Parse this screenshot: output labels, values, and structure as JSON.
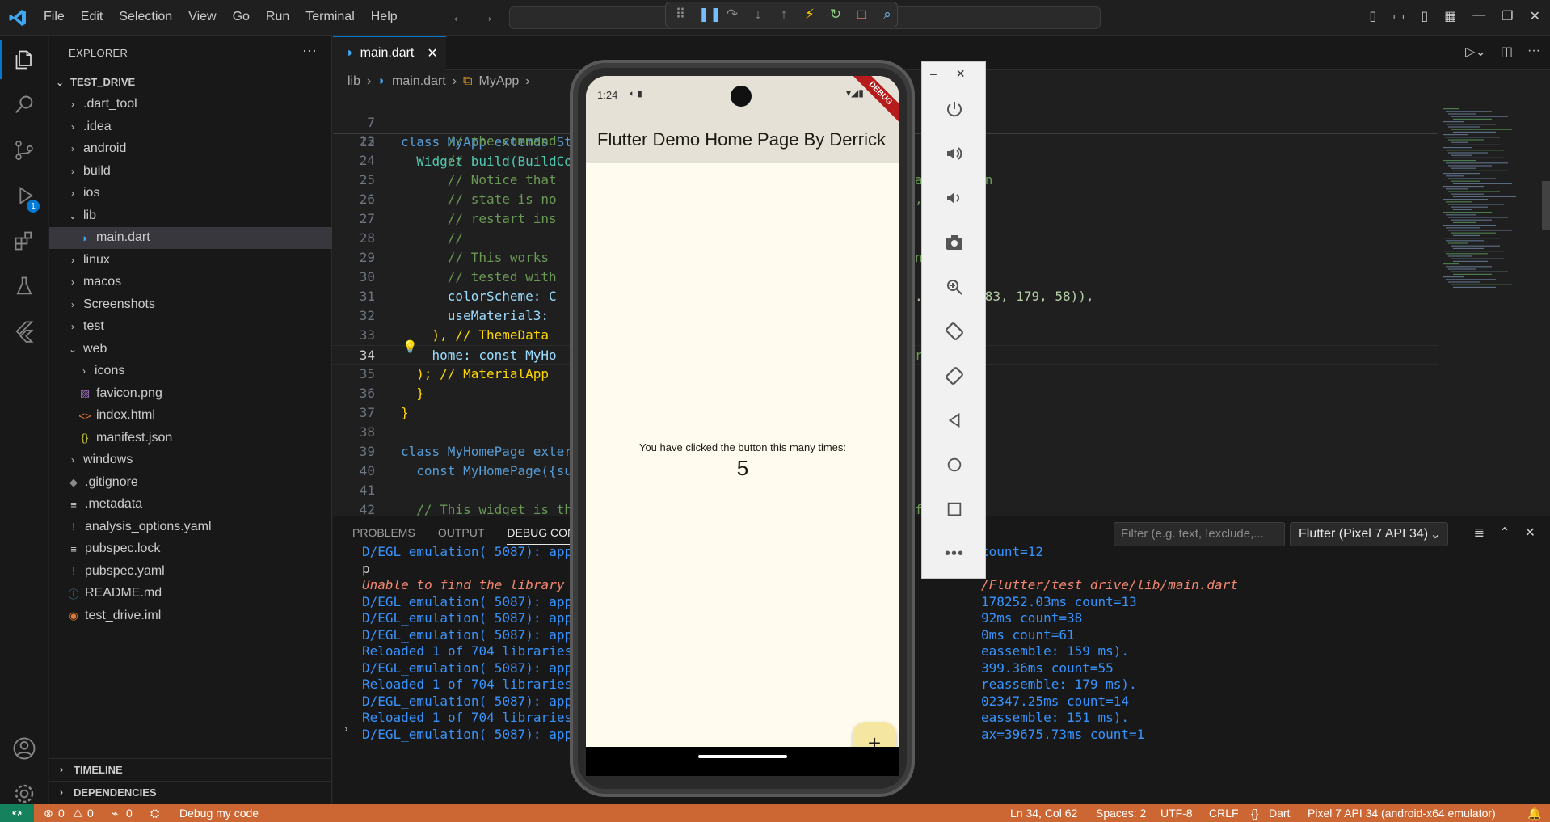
{
  "menu": [
    "File",
    "Edit",
    "Selection",
    "View",
    "Go",
    "Run",
    "Terminal",
    "Help"
  ],
  "sidebar": {
    "title": "EXPLORER",
    "root": "TEST_DRIVE",
    "items": [
      {
        "label": ".dart_tool",
        "type": "folder",
        "depth": 1,
        "open": false
      },
      {
        "label": ".idea",
        "type": "folder",
        "depth": 1,
        "open": false
      },
      {
        "label": "android",
        "type": "folder",
        "depth": 1,
        "open": false
      },
      {
        "label": "build",
        "type": "folder",
        "depth": 1,
        "open": false
      },
      {
        "label": "ios",
        "type": "folder",
        "depth": 1,
        "open": false
      },
      {
        "label": "lib",
        "type": "folder",
        "depth": 1,
        "open": true
      },
      {
        "label": "main.dart",
        "type": "dart",
        "depth": 2,
        "selected": true
      },
      {
        "label": "linux",
        "type": "folder",
        "depth": 1,
        "open": false
      },
      {
        "label": "macos",
        "type": "folder",
        "depth": 1,
        "open": false
      },
      {
        "label": "Screenshots",
        "type": "folder",
        "depth": 1,
        "open": false
      },
      {
        "label": "test",
        "type": "folder",
        "depth": 1,
        "open": false
      },
      {
        "label": "web",
        "type": "folder",
        "depth": 1,
        "open": true
      },
      {
        "label": "icons",
        "type": "folder",
        "depth": 2,
        "open": false
      },
      {
        "label": "favicon.png",
        "type": "image",
        "depth": 2
      },
      {
        "label": "index.html",
        "type": "html",
        "depth": 2
      },
      {
        "label": "manifest.json",
        "type": "json",
        "depth": 2
      },
      {
        "label": "windows",
        "type": "folder",
        "depth": 1,
        "open": false
      },
      {
        "label": ".gitignore",
        "type": "git",
        "depth": 1
      },
      {
        "label": ".metadata",
        "type": "text",
        "depth": 1
      },
      {
        "label": "analysis_options.yaml",
        "type": "yaml",
        "depth": 1
      },
      {
        "label": "pubspec.lock",
        "type": "text",
        "depth": 1
      },
      {
        "label": "pubspec.yaml",
        "type": "yaml",
        "depth": 1
      },
      {
        "label": "README.md",
        "type": "info",
        "depth": 1
      },
      {
        "label": "test_drive.iml",
        "type": "rss",
        "depth": 1
      }
    ],
    "sections": [
      "TIMELINE",
      "DEPENDENCIES"
    ]
  },
  "activity": {
    "run_badge": "1"
  },
  "editor": {
    "tab": "main.dart",
    "breadcrumb": [
      "lib",
      "main.dart",
      "MyApp"
    ],
    "sticky": [
      {
        "n": "7",
        "text": "class MyApp extends St"
      },
      {
        "n": "12",
        "text": "  Widget build(BuildCo"
      }
    ],
    "lines": [
      {
        "n": "23",
        "left": "      // the command",
        "right": ""
      },
      {
        "n": "24",
        "left": "      //",
        "right": ""
      },
      {
        "n": "25",
        "left": "      // Notice that",
        "right": "a location"
      },
      {
        "n": "26",
        "left": "      // state is no",
        "right": ","
      },
      {
        "n": "27",
        "left": "      // restart ins",
        "right": ""
      },
      {
        "n": "28",
        "left": "      //",
        "right": ""
      },
      {
        "n": "29",
        "left": "      // This works",
        "right": "n be"
      },
      {
        "n": "30",
        "left": "      // tested with",
        "right": ""
      },
      {
        "n": "31",
        "left": "      colorScheme: C",
        "right": ". (255, 183, 179, 58)),"
      },
      {
        "n": "32",
        "left": "      useMaterial3:",
        "right": ""
      },
      {
        "n": "33",
        "left": "    ), // ThemeData",
        "right": ""
      },
      {
        "n": "34",
        "left": "    home: const MyHo",
        "right": "r"
      },
      {
        "n": "35",
        "left": "  ); // MaterialApp",
        "right": ""
      },
      {
        "n": "36",
        "left": "  }",
        "right": ""
      },
      {
        "n": "37",
        "left": "}",
        "right": ""
      },
      {
        "n": "38",
        "left": "",
        "right": ""
      },
      {
        "n": "39",
        "left": "class MyHomePage exter",
        "right": ""
      },
      {
        "n": "40",
        "left": "  const MyHomePage({su",
        "right": ""
      },
      {
        "n": "41",
        "left": "",
        "right": ""
      },
      {
        "n": "42",
        "left": "  // This widget is th",
        "right": "f setting"
      }
    ]
  },
  "panel": {
    "tabs": [
      "PROBLEMS",
      "OUTPUT",
      "DEBUG CONSOLE"
    ],
    "filter_placeholder": "Filter (e.g. text, !exclude,...",
    "device": "Flutter (Pixel 7 API 34)",
    "output": [
      {
        "left": "D/EGL_emulation( 5087): app",
        "right": "count=12",
        "kind": "blue"
      },
      {
        "left": "p",
        "right": "",
        "kind": "plain"
      },
      {
        "left": "Unable to find the library",
        "right": "/Flutter/test_drive/lib/main.dart",
        "kind": "err"
      },
      {
        "left": "D/EGL_emulation( 5087): app",
        "right": "178252.03ms count=13",
        "kind": "blue"
      },
      {
        "left": "D/EGL_emulation( 5087): app",
        "right": "92ms count=38",
        "kind": "blue"
      },
      {
        "left": "D/EGL_emulation( 5087): app",
        "right": "0ms count=61",
        "kind": "blue"
      },
      {
        "left": "Reloaded 1 of 704 libraries",
        "right": "eassemble: 159 ms).",
        "kind": "blue"
      },
      {
        "left": "D/EGL_emulation( 5087): app",
        "right": "399.36ms count=55",
        "kind": "blue"
      },
      {
        "left": "Reloaded 1 of 704 libraries",
        "right": "reassemble: 179 ms).",
        "kind": "blue"
      },
      {
        "left": "D/EGL_emulation( 5087): app",
        "right": "02347.25ms count=14",
        "kind": "blue"
      },
      {
        "left": "Reloaded 1 of 704 libraries",
        "right": "eassemble: 151 ms).",
        "kind": "blue"
      },
      {
        "left": "D/EGL_emulation( 5087): app",
        "right": "ax=39675.73ms count=1",
        "kind": "blue"
      }
    ]
  },
  "phone": {
    "time": "1:24",
    "app_title": "Flutter Demo Home Page By Derrick",
    "ribbon": "DEBUG",
    "counter_label": "You have clicked the button this many times:",
    "counter_value": "5",
    "fab": "+"
  },
  "statusbar": {
    "errors": "0",
    "warnings": "0",
    "ports": "0",
    "debug_label": "Debug my code",
    "position": "Ln 34, Col 62",
    "spaces": "Spaces: 2",
    "encoding": "UTF-8",
    "eol": "CRLF",
    "language": "Dart",
    "device": "Pixel 7 API 34 (android-x64 emulator)"
  }
}
